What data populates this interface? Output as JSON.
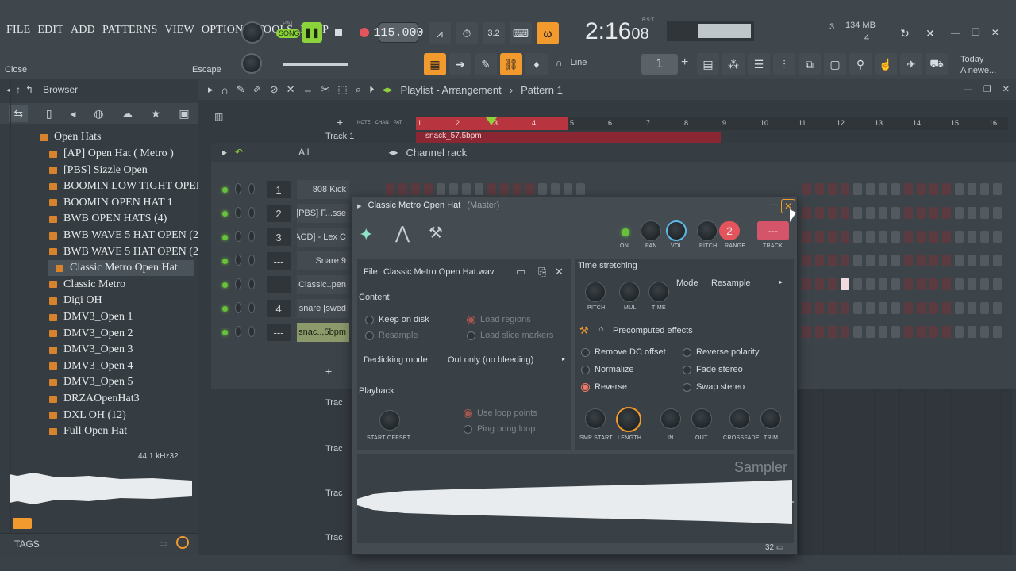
{
  "menu": [
    "FILE",
    "EDIT",
    "ADD",
    "PATTERNS",
    "VIEW",
    "OPTIONS",
    "TOOLS",
    "HELP"
  ],
  "transport": {
    "pat": "PAT",
    "song": "SONG",
    "tempo": "115.000",
    "time_main": "2:16",
    "time_sub": "08",
    "time_unit": "B:S:T"
  },
  "hint": {
    "left": "Close",
    "right": "Escape"
  },
  "cpu": {
    "voices": "3",
    "mem": "134 MB",
    "cores": "4"
  },
  "snap": {
    "label": "Line"
  },
  "news": {
    "when": "Today",
    "text": "A newe..."
  },
  "browser": {
    "title": "Browser",
    "filter": "All",
    "folder": "Open Hats",
    "items": [
      "[AP] Open Hat ( Metro )",
      "[PBS] Sizzle Open",
      "BOOMIN LOW TIGHT OPEN HAT",
      "BOOMIN OPEN HAT 1",
      "BWB OPEN HATS (4)",
      "BWB WAVE 5 HAT OPEN (2)",
      "BWB WAVE 5 HAT OPEN (20)",
      "Classic Metro Open Hat",
      "Classic Metro",
      "Digi OH",
      "DMV3_Open 1",
      "DMV3_Open 2",
      "DMV3_Open 3",
      "DMV3_Open 4",
      "DMV3_Open 5",
      "DRZAOpenHat3",
      "DXL OH (12)",
      "Full Open Hat"
    ],
    "selected_index": 7,
    "sample_rate": "44.1 kHz",
    "bits": "32",
    "tags": "TAGS"
  },
  "playlist": {
    "title": "Playlist - Arrangement",
    "sep": "›",
    "pattern": "Pattern 1",
    "mini_labels": [
      "NOTE",
      "CHAN",
      "PAT"
    ],
    "bars": [
      "1",
      "2",
      "3",
      "4",
      "5",
      "6",
      "7",
      "8",
      "9",
      "10",
      "11",
      "12",
      "13",
      "14",
      "15",
      "16"
    ],
    "track1": "Track 1",
    "clip": "snack_57.5bpm",
    "track_short": "Trac"
  },
  "rack": {
    "title": "Channel rack",
    "filter": "All",
    "channels": [
      {
        "num": "1",
        "name": "808 Kick"
      },
      {
        "num": "2",
        "name": "[PBS] F...sse"
      },
      {
        "num": "3",
        "name": "[ACD] - Lex C"
      },
      {
        "num": "---",
        "name": "Snare 9"
      },
      {
        "num": "---",
        "name": "Classic..pen"
      },
      {
        "num": "4",
        "name": "snare [swed"
      },
      {
        "num": "---",
        "name": "snac..,5bpm"
      }
    ],
    "add": "+"
  },
  "sampler": {
    "title": "Classic Metro Open Hat",
    "master": "(Master)",
    "knob_labels": {
      "on": "ON",
      "pan": "PAN",
      "vol": "VOL",
      "pitch": "PITCH",
      "range": "RANGE",
      "track": "TRACK"
    },
    "range_value": "2",
    "track_value": "---",
    "file_label": "File",
    "file_name": "Classic Metro Open Hat.wav",
    "content": "Content",
    "keep_on_disk": "Keep on disk",
    "resample": "Resample",
    "load_regions": "Load regions",
    "load_slice": "Load slice markers",
    "declick_label": "Declicking mode",
    "declick_value": "Out only (no bleeding)",
    "playback": "Playback",
    "use_loop": "Use loop points",
    "ping_pong": "Ping pong loop",
    "start_offset": "START OFFSET",
    "ts_title": "Time stretching",
    "ts_pitch": "PITCH",
    "ts_mul": "MUL",
    "ts_time": "TIME",
    "mode_label": "Mode",
    "mode_value": "Resample",
    "pe_title": "Precomputed effects",
    "effects": [
      "Remove DC offset",
      "Reverse polarity",
      "Normalize",
      "Fade stereo",
      "Reverse",
      "Swap stereo"
    ],
    "fx_knobs": [
      "SMP START",
      "LENGTH",
      "IN",
      "OUT",
      "CROSSFADE",
      "TRIM"
    ],
    "brand": "Sampler",
    "bits": "32"
  },
  "colors": {
    "accent": "#f29a2e",
    "green": "#67c23a",
    "red": "#e2555d",
    "clip": "#8b2732"
  }
}
